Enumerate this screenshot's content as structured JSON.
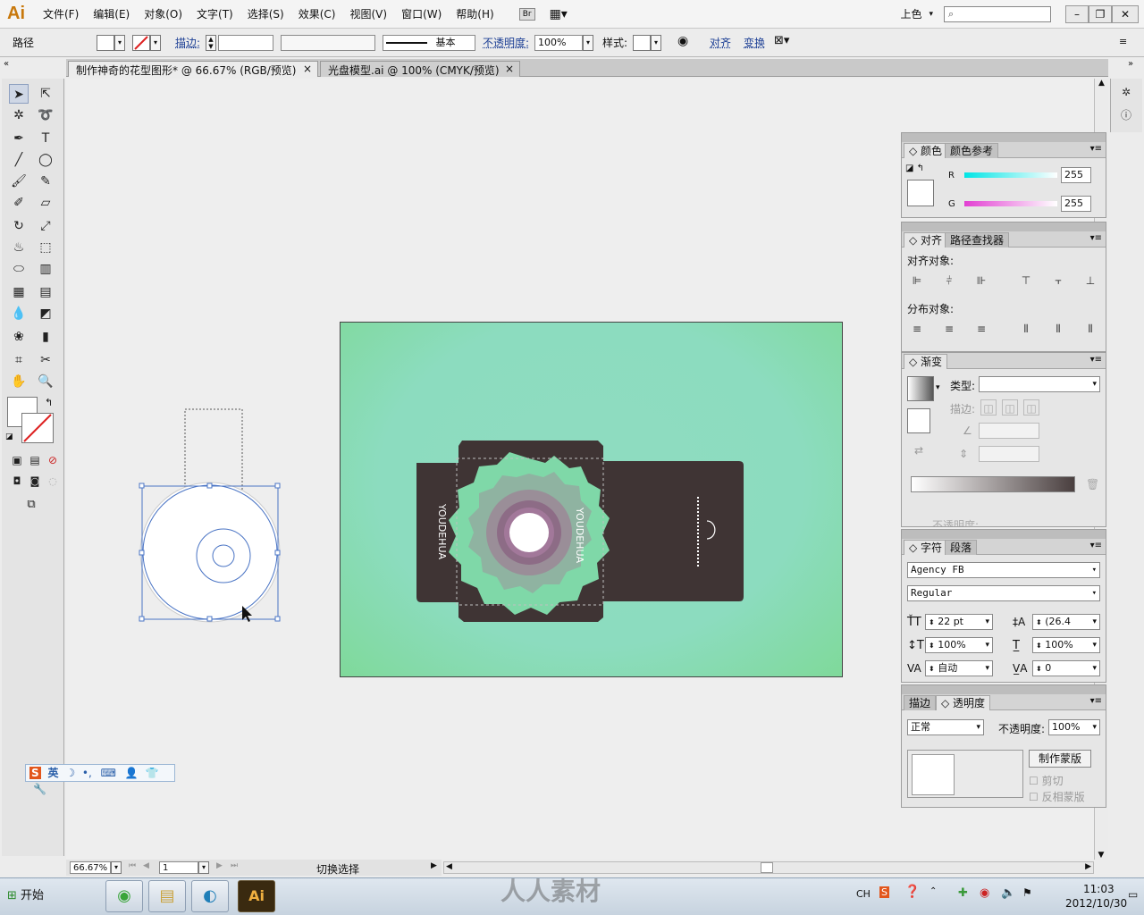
{
  "app": {
    "logo": "Ai"
  },
  "menu": {
    "items": [
      "文件(F)",
      "编辑(E)",
      "对象(O)",
      "文字(T)",
      "选择(S)",
      "效果(C)",
      "视图(V)",
      "窗口(W)",
      "帮助(H)"
    ],
    "br": "Br",
    "workspace": "上色",
    "search_placeholder": ""
  },
  "control": {
    "object_label": "路径",
    "stroke_label": "描边:",
    "stroke_style": "基本",
    "opacity_label": "不透明度:",
    "opacity_value": "100%",
    "style_label": "样式:",
    "align_label": "对齐",
    "transform_label": "变换"
  },
  "tabs": [
    {
      "label": "制作神奇的花型图形* @ 66.67% (RGB/预览)",
      "close": "×"
    },
    {
      "label": "光盘模型.ai @ 100% (CMYK/预览)",
      "close": "×"
    }
  ],
  "status": {
    "zoom": "66.67%",
    "page": "1",
    "mode": "切换选择"
  },
  "panels": {
    "color": {
      "tabs": [
        "颜色",
        "颜色参考"
      ],
      "r_label": "R",
      "r_value": "255",
      "g_label": "G",
      "g_value": "255"
    },
    "align": {
      "tabs": [
        "对齐",
        "路径查找器"
      ],
      "align_objects": "对齐对象:",
      "distribute_objects": "分布对象:"
    },
    "gradient": {
      "tab": "渐变",
      "type_label": "类型:",
      "stroke_label": "描边:",
      "opacity_label": "不透明度:"
    },
    "character": {
      "tabs": [
        "字符",
        "段落"
      ],
      "font": "Agency FB",
      "style": "Regular",
      "size": "22 pt",
      "leading": "(26.4",
      "vscale": "100%",
      "hscale": "100%",
      "kerning": "自动",
      "tracking": "0"
    },
    "transparency": {
      "tabs": [
        "描边",
        "透明度"
      ],
      "mode": "正常",
      "opacity_label": "不透明度:",
      "opacity_value": "100%",
      "make_mask": "制作蒙版",
      "clip": "剪切",
      "invert": "反相蒙版"
    }
  },
  "artwork": {
    "brand": "YOUDEHUA"
  },
  "ime": {
    "label": "英"
  },
  "taskbar": {
    "start": "开始",
    "lang": "CH",
    "time": "11:03",
    "date": "2012/10/30",
    "active_app": "Ai"
  },
  "watermark": "人人素材",
  "colors": {
    "accent": "#1c3f95",
    "artboard": "#8cdcbf",
    "sleeve": "#3f3434",
    "flower": "#7fd8a8"
  }
}
